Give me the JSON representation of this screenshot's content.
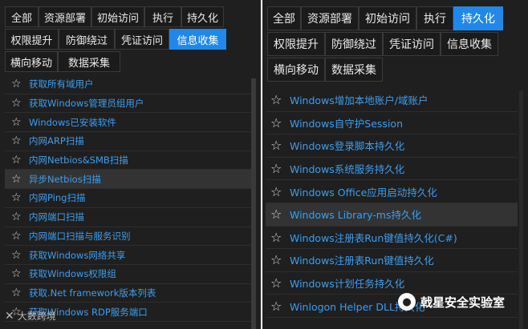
{
  "left": {
    "tab_rows": [
      [
        {
          "label": "全部",
          "width": 42
        },
        {
          "label": "资源部署",
          "width": 66
        },
        {
          "label": "初始访问",
          "width": 66
        },
        {
          "label": "执行",
          "width": 46
        },
        {
          "label": "持久化",
          "width": 53
        }
      ],
      [
        {
          "label": "权限提升",
          "width": 67
        },
        {
          "label": "防御绕过",
          "width": 70
        },
        {
          "label": "凭证访问",
          "width": 68
        },
        {
          "label": "信息收集",
          "width": 71,
          "active": true
        }
      ],
      [
        {
          "label": "横向移动",
          "width": 66
        },
        {
          "label": "数据采集",
          "width": 78
        }
      ]
    ],
    "items": [
      {
        "label": "获取所有域用户"
      },
      {
        "label": "获取Windows管理员组用户"
      },
      {
        "label": "Windows已安装软件"
      },
      {
        "label": "内网ARP扫描"
      },
      {
        "label": "内网Netbios&SMB扫描"
      },
      {
        "label": "异步Netbios扫描",
        "highlight": true
      },
      {
        "label": "内网Ping扫描"
      },
      {
        "label": "内网端口扫描"
      },
      {
        "label": "内网端口扫描与服务识别"
      },
      {
        "label": "获取Windows网络共享"
      },
      {
        "label": "获取Windows权限组"
      },
      {
        "label": "获取.Net framework版本列表"
      },
      {
        "label": "获取Windows RDP服务端口"
      }
    ],
    "watermark": "大数跨境",
    "watermark_icon": "arrow-logo-icon"
  },
  "right": {
    "tab_rows": [
      [
        {
          "label": "全部",
          "width": 42
        },
        {
          "label": "资源部署",
          "width": 72
        },
        {
          "label": "初始访问",
          "width": 72
        },
        {
          "label": "执行",
          "width": 46
        },
        {
          "label": "持久化",
          "width": 62,
          "active": true
        }
      ],
      [
        {
          "label": "权限提升",
          "width": 72
        },
        {
          "label": "防御绕过",
          "width": 72
        },
        {
          "label": "凭证访问",
          "width": 72
        },
        {
          "label": "信息收集",
          "width": 72
        }
      ],
      [
        {
          "label": "横向移动",
          "width": 72
        },
        {
          "label": "数据采集",
          "width": 72
        }
      ]
    ],
    "items": [
      {
        "label": "Windows增加本地账户/域账户"
      },
      {
        "label": "Windows自守护Session"
      },
      {
        "label": "Windows登录脚本持久化"
      },
      {
        "label": "Windows系统服务持久化"
      },
      {
        "label": "Windows Office应用启动持久化"
      },
      {
        "label": "Windows Library-ms持久化",
        "highlight": true
      },
      {
        "label": "Windows注册表Run键值持久化(C#)"
      },
      {
        "label": "Windows注册表Run键值持久化"
      },
      {
        "label": "Windows计划任务持久化"
      },
      {
        "label": "Winlogon Helper DLL持久化"
      }
    ],
    "watermark": "戟星安全实验室",
    "watermark_icon": "wechat-logo-icon"
  },
  "icon_names": {
    "favorite": "star-outline-icon"
  },
  "colors": {
    "accent": "#1f88ea",
    "link": "#3c9ef0",
    "panel": "#1f1f1f"
  }
}
